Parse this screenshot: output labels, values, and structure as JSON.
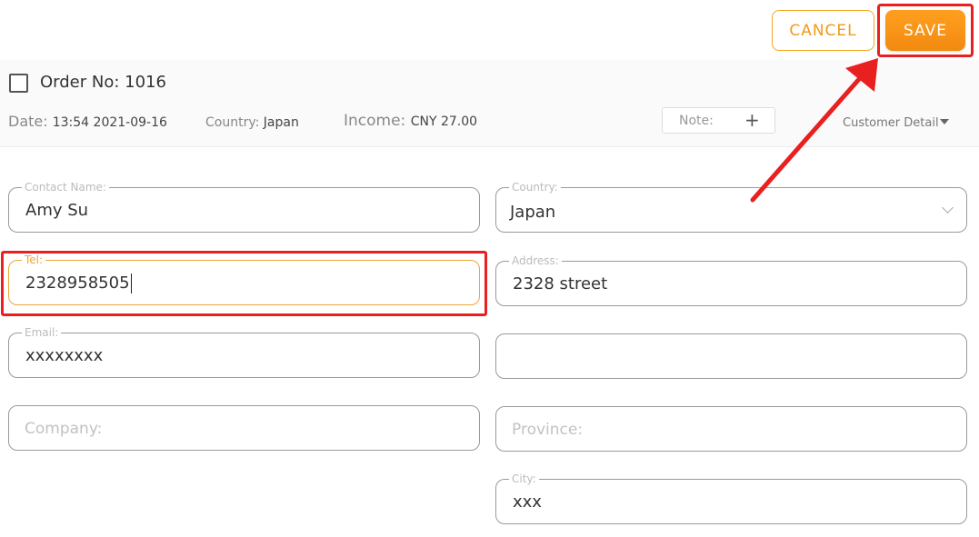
{
  "toolbar": {
    "cancel_label": "CANCEL",
    "save_label": "SAVE"
  },
  "order": {
    "title": "Order No: 1016",
    "date_label": "Date:",
    "date_value": "13:54 2021-09-16",
    "country_label": "Country:",
    "country_value": "Japan",
    "income_label": "Income:",
    "income_value": "CNY 27.00",
    "note_label": "Note:",
    "note_add_icon": "+",
    "customer_detail_label": "Customer Detail"
  },
  "form": {
    "contact_name": {
      "label": "Contact Name:",
      "value": "Amy Su"
    },
    "tel": {
      "label": "Tel:",
      "value": "2328958505"
    },
    "email": {
      "label": "Email:",
      "value": "xxxxxxxx"
    },
    "company": {
      "placeholder": "Company:"
    },
    "country": {
      "label": "Country:",
      "value": "Japan"
    },
    "address": {
      "label": "Address:",
      "value": "2328 street"
    },
    "address2": {
      "value": ""
    },
    "province": {
      "placeholder": "Province:"
    },
    "city": {
      "label": "City:",
      "value": "xxx"
    }
  },
  "colors": {
    "accent": "#f5a623",
    "save_bg": "#f7941d",
    "annotation": "#e82020"
  },
  "icons": {
    "checkbox": "checkbox-icon",
    "note_add": "plus-icon",
    "customer_detail_toggle": "caret-down-icon",
    "country_dropdown": "chevron-down-icon"
  }
}
